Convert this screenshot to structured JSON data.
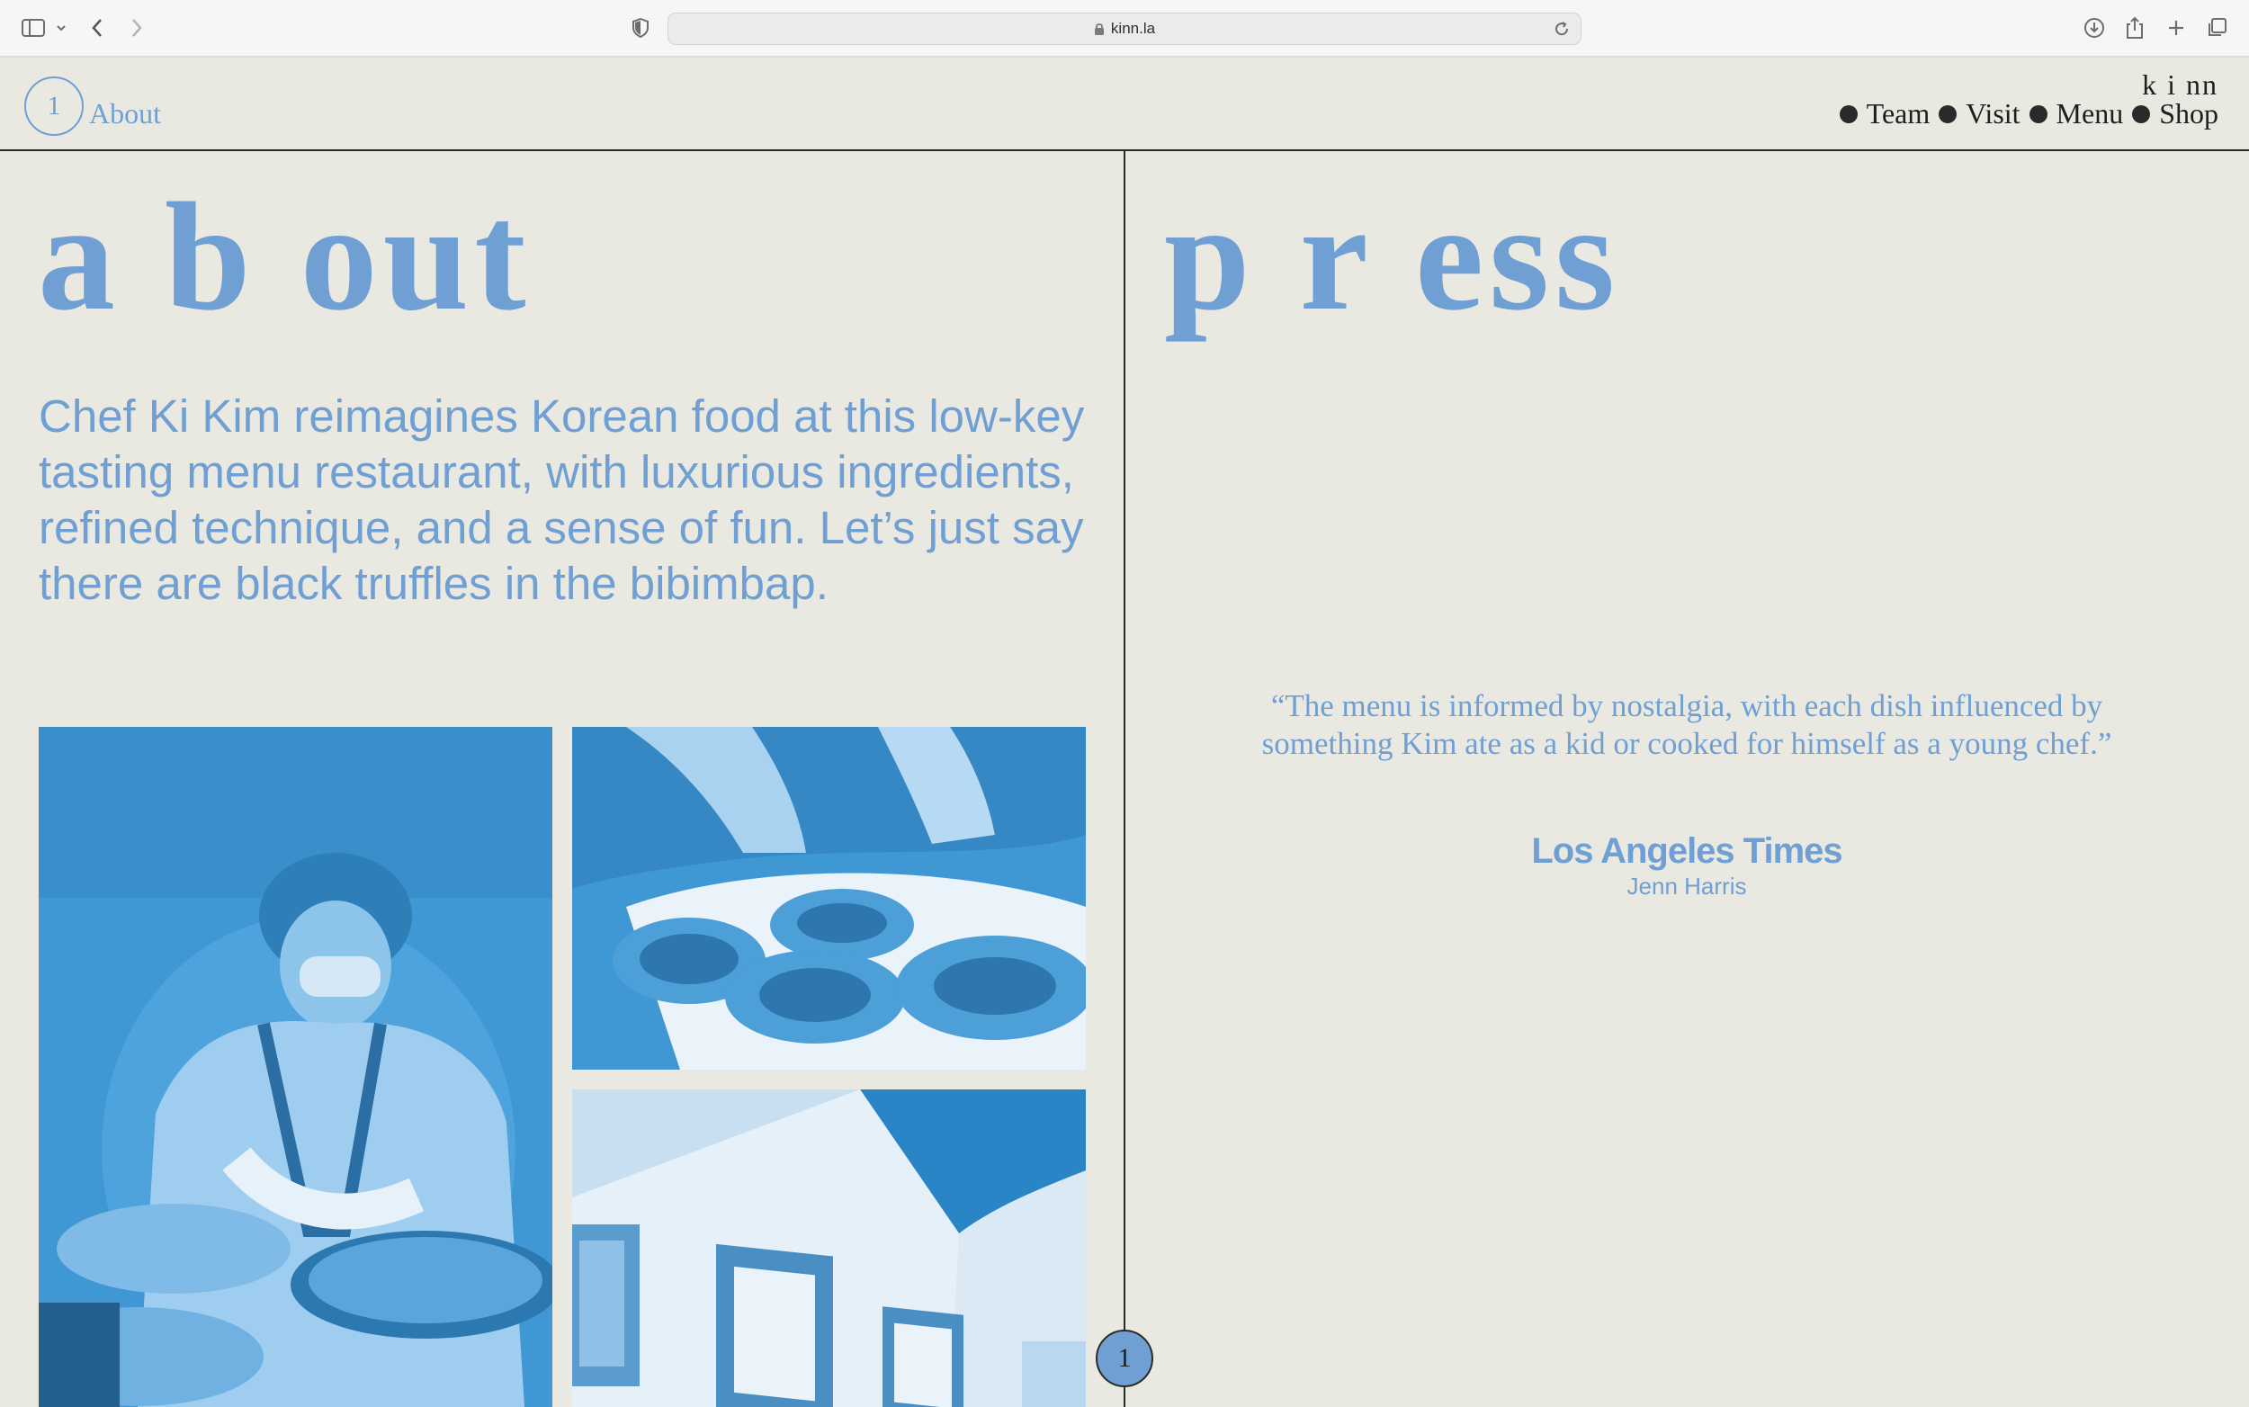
{
  "browser": {
    "url": "kinn.la"
  },
  "header": {
    "page_number": "1",
    "page_label": "About",
    "brand": "k i nn",
    "nav": [
      {
        "label": "Team"
      },
      {
        "label": "Visit"
      },
      {
        "label": "Menu"
      },
      {
        "label": "Shop"
      }
    ]
  },
  "about": {
    "title": "a b out",
    "text": "Chef Ki Kim reimagines Korean food at this low-key tasting menu restaurant, with luxurious ingredients, refined technique, and a sense of fun. Let’s just say there are black truffles in the bibimbap."
  },
  "press": {
    "title": "p r ess",
    "quote": "“The menu is informed by nostalgia, with each dish influenced by something Kim ate as a kid or cooked for himself as a young chef.”",
    "source": "Los Angeles Times",
    "author": "Jenn Harris"
  },
  "floating_badge": "1",
  "colors": {
    "accent": "#6f9fd3",
    "background": "#e9e9e2",
    "ink": "#1e1e1e"
  }
}
